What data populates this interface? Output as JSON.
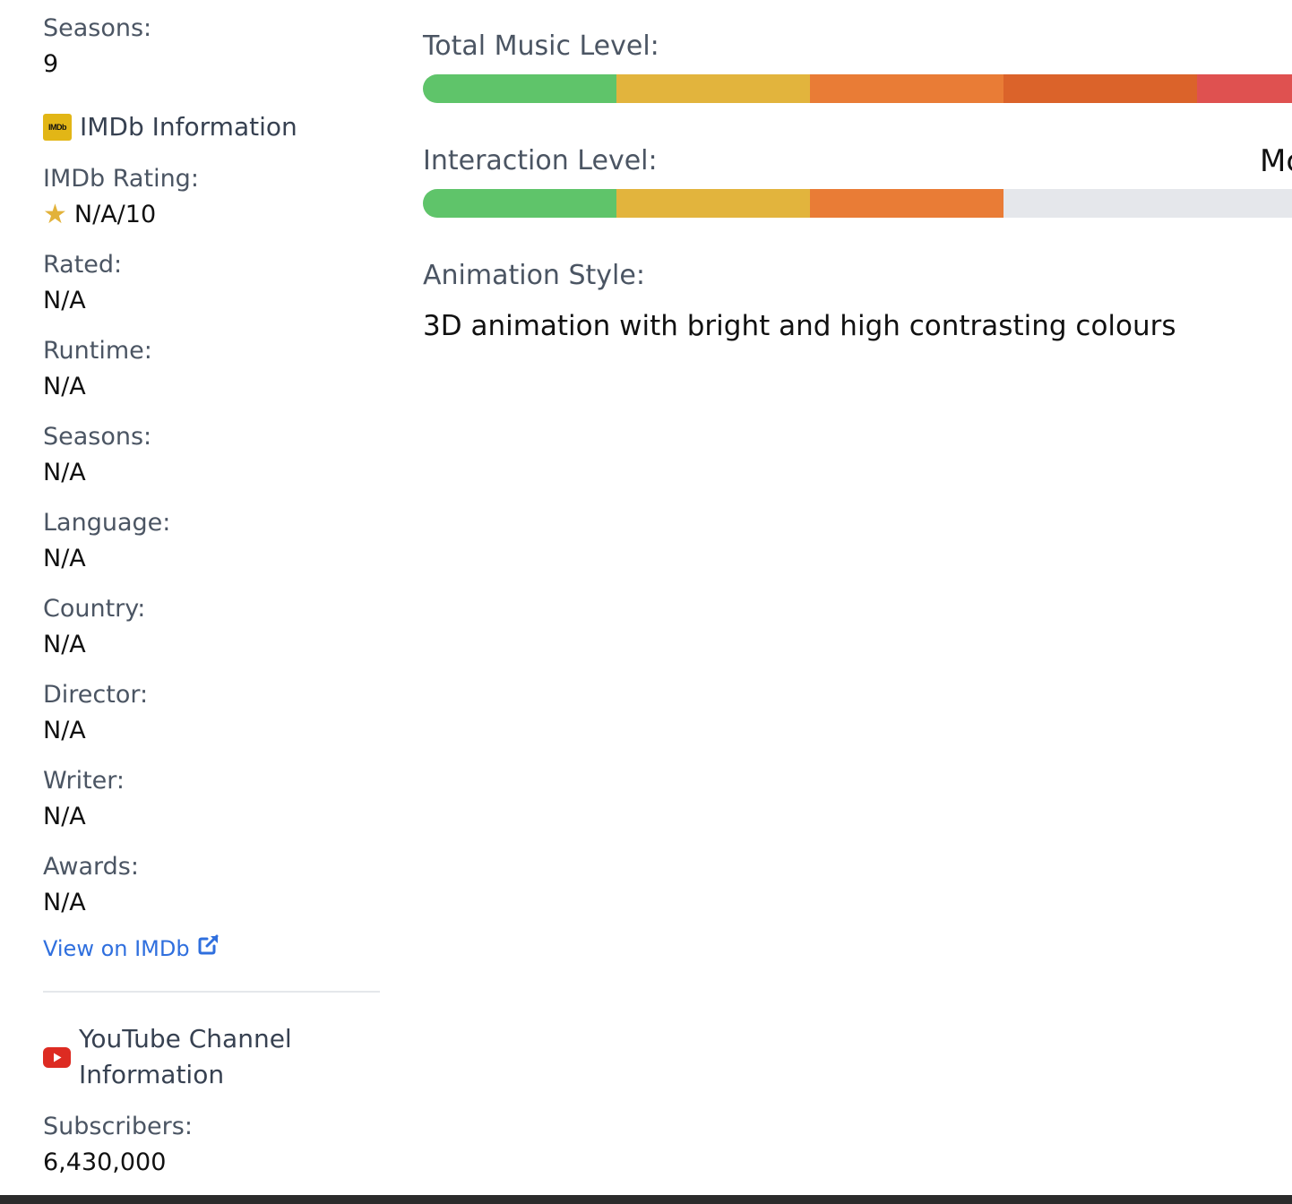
{
  "sidebar": {
    "seasons_top": {
      "label": "Seasons:",
      "value": "9"
    },
    "imdb": {
      "logo_text": "IMDb",
      "title": "IMDb Information",
      "rating_label": "IMDb Rating:",
      "rating_value": "N/A/10",
      "fields": [
        {
          "label": "Rated:",
          "value": "N/A"
        },
        {
          "label": "Runtime:",
          "value": "N/A"
        },
        {
          "label": "Seasons:",
          "value": "N/A"
        },
        {
          "label": "Language:",
          "value": "N/A"
        },
        {
          "label": "Country:",
          "value": "N/A"
        },
        {
          "label": "Director:",
          "value": "N/A"
        },
        {
          "label": "Writer:",
          "value": "N/A"
        },
        {
          "label": "Awards:",
          "value": "N/A"
        }
      ],
      "link_text": "View on IMDb"
    },
    "youtube": {
      "title_line1": "YouTube Channel",
      "title_line2": "Information",
      "subscribers_label": "Subscribers:",
      "subscribers_value": "6,430,000"
    }
  },
  "main": {
    "music": {
      "label": "Total Music Level:",
      "level": 5,
      "max": 5
    },
    "interaction": {
      "label": "Interaction Level:",
      "level": 3,
      "max": 5,
      "right_text": "Mc"
    },
    "animation": {
      "label": "Animation Style:",
      "value": "3D animation with bright and high contrasting colours"
    }
  },
  "colors": {
    "seg1": "#5fc46a",
    "seg2": "#e2b43d",
    "seg3": "#e97c36",
    "seg4": "#db632a",
    "seg5": "#df5150",
    "empty": "#e5e7eb",
    "link": "#2f6fde",
    "star": "#e2b23a",
    "youtube": "#dd2b22"
  }
}
